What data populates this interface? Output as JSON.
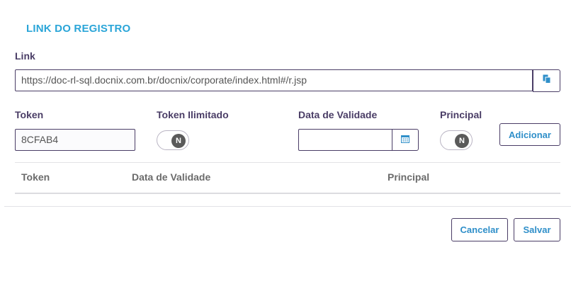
{
  "title": "LINK DO REGISTRO",
  "link": {
    "label": "Link",
    "value": "https://doc-rl-sql.docnix.com.br/docnix/corporate/index.html#/r.jsp",
    "copy_icon": "copy-icon"
  },
  "token": {
    "label": "Token",
    "value": "8CFAB4"
  },
  "token_ilimitado": {
    "label": "Token Ilimitado",
    "toggle_text": "N"
  },
  "data_validade": {
    "label": "Data de Validade",
    "value": "",
    "calendar_icon": "calendar-icon"
  },
  "principal": {
    "label": "Principal",
    "toggle_text": "N"
  },
  "add_button": "Adicionar",
  "table": {
    "columns": [
      "Token",
      "Data de Validade",
      "Principal"
    ]
  },
  "footer": {
    "cancel": "Cancelar",
    "save": "Salvar"
  },
  "colors": {
    "accent": "#2aa5d8",
    "label": "#4a3d66",
    "border": "#4a3d66"
  }
}
